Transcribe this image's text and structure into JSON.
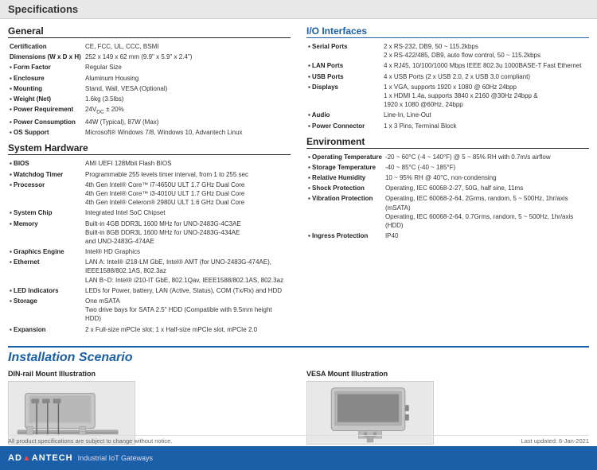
{
  "page": {
    "title": "Specifications"
  },
  "general": {
    "heading": "General",
    "items": [
      {
        "label": "Certification",
        "value": "CE, FCC, UL, CCC, BSMI"
      },
      {
        "label": "Dimensions (W x D x H)",
        "value": "252 x 149 x 62 mm (9.9\" x 5.9\" x 2.4\")"
      },
      {
        "label": "Form Factor",
        "value": "Regular Size"
      },
      {
        "label": "Enclosure",
        "value": "Aluminum Housing"
      },
      {
        "label": "Mounting",
        "value": "Stand, Wall, VESA (Optional)"
      },
      {
        "label": "Weight (Net)",
        "value": "1.6kg (3.5lbs)"
      },
      {
        "label": "Power Requirement",
        "value": "24VDC ± 20%"
      },
      {
        "label": "Power Consumption",
        "value": "44W (Typical), 87W (Max)"
      },
      {
        "label": "OS Support",
        "value": "Microsoft® Windows 7/8, Windows 10, Advantech Linux"
      }
    ]
  },
  "system_hardware": {
    "heading": "System Hardware",
    "items": [
      {
        "label": "BIOS",
        "value": "AMI UEFI 128Mbit Flash BIOS"
      },
      {
        "label": "Watchdog Timer",
        "value": "Programmable 255 levels timer interval, from 1 to 255 sec"
      },
      {
        "label": "Processor",
        "value": "4th Gen Intel® Core™ i7-4650U ULT 1.7 GHz Dual Core\n4th Gen Intel® Core™ i3-4010U ULT 1.7 GHz Dual Core\n4th Gen Intel® Celeron® 2980U ULT 1.6 GHz Dual Core"
      },
      {
        "label": "System Chip",
        "value": "Integrated Intel SoC Chipset"
      },
      {
        "label": "Memory",
        "value": "Built-in 4GB DDR3L 1600 MHz for UNO-2483G-4C3AE\nBuilt-in 8GB DDR3L 1600 MHz for UNO-2483G-434AE\nand UNO-2483G-474AE"
      },
      {
        "label": "Graphics Engine",
        "value": "Intel® HD Graphics"
      },
      {
        "label": "Ethernet",
        "value": "LAN A: Intel® i218-LM GbE, Intel® AMT (for UNO-2483G-474AE), IEEE1588/802.1AS, 802.3az\nLAN B~D: Intel® i210-IT GbE, 802.1Qav, IEEE1588/802.1AS, 802.3az"
      },
      {
        "label": "LED Indicators",
        "value": "LEDs for Power, battery, LAN (Active, Status), COM (Tx/Rx) and HDD"
      },
      {
        "label": "Storage",
        "value": "One mSATA\nTwo drive bays for SATA 2.5\" HDD (Compatible with 9.5mm height HDD)"
      },
      {
        "label": "Expansion",
        "value": "2 x Full-size mPCIe slot; 1 x Half-size mPCIe slot, mPCIe 2.0"
      }
    ]
  },
  "io_interfaces": {
    "heading": "I/O Interfaces",
    "items": [
      {
        "label": "Serial Ports",
        "value": "2 x RS-232, DB9, 50 ~ 115.2kbps\n2 x RS-422/485, DB9, auto flow control, 50 ~ 115.2kbps"
      },
      {
        "label": "LAN Ports",
        "value": "4 x RJ45, 10/100/1000 Mbps IEEE 802.3u 1000BASE-T Fast Ethernet"
      },
      {
        "label": "USB Ports",
        "value": "4 x USB Ports (2 x USB 2.0, 2 x USB 3.0 compliant)"
      },
      {
        "label": "Displays",
        "value": "1 x VGA, supports 1920 x 1080 @ 60Hz 24bpp\n1 x HDMI 1.4a, supports 3840 x 2160 @30Hz 24bpp &\n1920 x 1080 @60Hz, 24bpp"
      },
      {
        "label": "Audio",
        "value": "Line-In, Line-Out"
      },
      {
        "label": "Power Connector",
        "value": "1 x 3 Pins, Terminal Block"
      }
    ]
  },
  "environment": {
    "heading": "Environment",
    "items": [
      {
        "label": "Operating Temperature",
        "value": "-20 ~ 60°C (-4 ~ 140°F) @ 5 ~ 85% RH with 0.7m/s airflow"
      },
      {
        "label": "Storage Temperature",
        "value": "-40 ~ 85°C (-40 ~ 185°F)"
      },
      {
        "label": "Relative Humidity",
        "value": "10 ~ 95% RH @ 40°C, non-condensing"
      },
      {
        "label": "Shock Protection",
        "value": "Operating, IEC 60068-2-27, 50G, half sine, 11ms"
      },
      {
        "label": "Vibration Protection",
        "value": "Operating, IEC 60068-2-64, 2Grms, random, 5 ~ 500Hz, 1hr/axis (mSATA)\nOperating, IEC 60068-2-64, 0.7Grms, random, 5 ~ 500Hz, 1hr/axis (HDD)"
      },
      {
        "label": "Ingress Protection",
        "value": "IP40"
      }
    ]
  },
  "installation": {
    "heading": "Installation Scenario",
    "din_rail": {
      "title": "DIN-rail Mount Illustration"
    },
    "vesa": {
      "title": "VESA Mount Illustration"
    }
  },
  "footer": {
    "logo": "ADANTECH",
    "logo_styled": "ADV|ANTECH",
    "subtitle": "Industrial IoT Gateways",
    "note_left": "All product specifications are subject to change without notice.",
    "note_right": "Last updated: 6-Jan-2021"
  }
}
